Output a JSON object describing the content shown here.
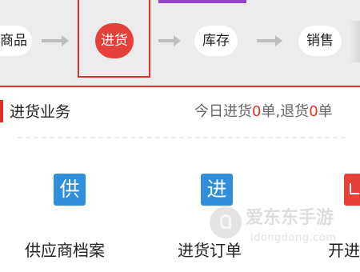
{
  "flow": {
    "steps": [
      {
        "label": "商品",
        "active": false
      },
      {
        "label": "进货",
        "active": true
      },
      {
        "label": "库存",
        "active": false
      },
      {
        "label": "销售",
        "active": false
      }
    ],
    "colors": {
      "active": "#e5403a",
      "bar": "#ececec",
      "arrow": "#bdbdbd"
    }
  },
  "section": {
    "title": "进货业务",
    "stats_prefix": "今日进货",
    "purchase_count": "0",
    "purchase_unit": "单",
    "separator": ",",
    "return_prefix": "退货",
    "return_count": "0",
    "return_unit": "单"
  },
  "tiles": [
    {
      "glyph": "供",
      "label": "供应商档案",
      "icon": "supplier-icon",
      "color": "#2f8fdd"
    },
    {
      "glyph": "进",
      "label": "进货订单",
      "icon": "purchase-order-icon",
      "color": "#2f8fdd"
    },
    {
      "glyph": "",
      "label": "开进",
      "icon": "open-purchase-icon",
      "color": "#e5403a"
    }
  ],
  "watermark": {
    "title": "爱东东手游",
    "url": "idongdong.com"
  },
  "colors": {
    "accent_red": "#e0302a",
    "accent_blue": "#2f8fdd"
  }
}
